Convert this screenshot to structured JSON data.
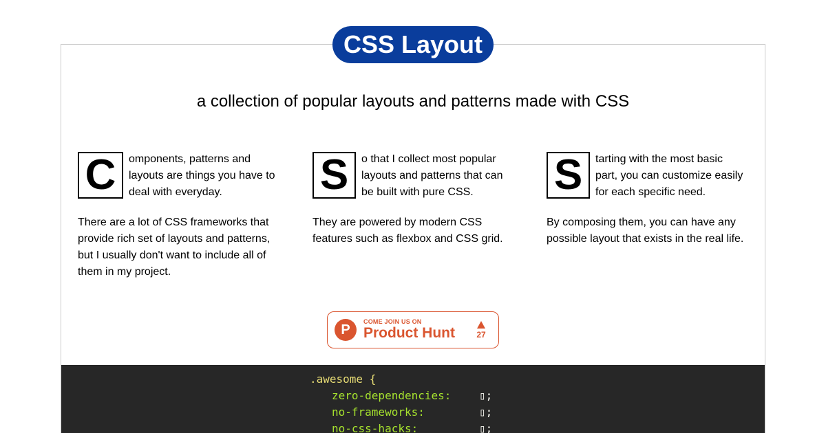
{
  "header": {
    "brand": "CSS Layout",
    "tagline": "a collection of popular layouts and patterns made with CSS"
  },
  "columns": [
    {
      "dropcap": "C",
      "intro": "omponents, patterns and layouts are things you have to deal with everyday.",
      "body": "There are a lot of CSS frameworks that provide rich set of layouts and patterns, but I usually don't want to include all of them in my project."
    },
    {
      "dropcap": "S",
      "intro": "o that I collect most popular layouts and patterns that can be built with pure CSS.",
      "body": "They are powered by modern CSS features such as flexbox and CSS grid."
    },
    {
      "dropcap": "S",
      "intro": "tarting with the most basic part, you can customize easily for each specific need.",
      "body": "By composing them, you can have any possible layout that exists in the real life."
    }
  ],
  "product_hunt": {
    "logo_letter": "P",
    "small_label": "COME JOIN US ON",
    "name": "Product Hunt",
    "votes": "27",
    "color": "#da552f"
  },
  "code": {
    "selector": ".awesome",
    "open_brace": "{",
    "properties": [
      {
        "name": "zero-dependencies:",
        "value": "▯",
        "end": ";"
      },
      {
        "name": "no-frameworks:",
        "value": "▯",
        "end": ";"
      },
      {
        "name": "no-css-hacks:",
        "value": "▯",
        "end": ";"
      }
    ]
  }
}
